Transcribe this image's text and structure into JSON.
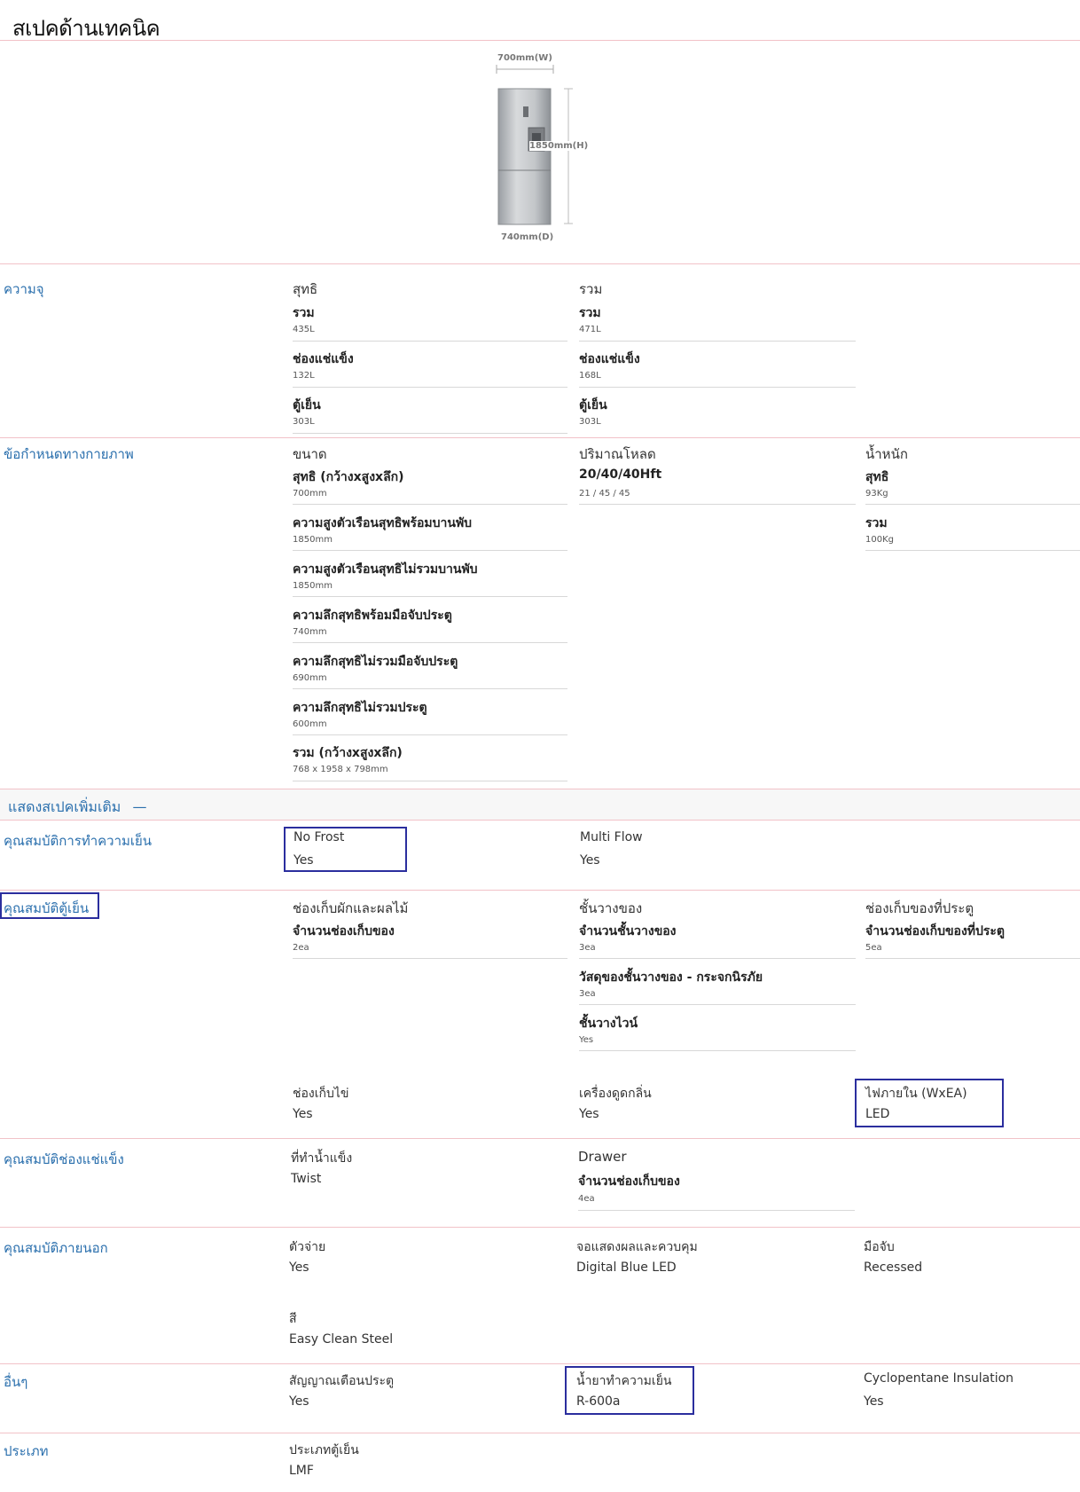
{
  "page_title": "สเปคด้านเทคนิค",
  "figure": {
    "width_label": "700mm(W)",
    "height_label": "1850mm(H)",
    "depth_label": "740mm(D)"
  },
  "capacity": {
    "label": "ความจุ",
    "net": {
      "heading": "สุทธิ",
      "items": [
        {
          "name": "รวม",
          "value": "435L"
        },
        {
          "name": "ช่องแช่แข็ง",
          "value": "132L"
        },
        {
          "name": "ตู้เย็น",
          "value": "303L"
        }
      ]
    },
    "total": {
      "heading": "รวม",
      "items": [
        {
          "name": "รวม",
          "value": "471L"
        },
        {
          "name": "ช่องแช่แข็ง",
          "value": "168L"
        },
        {
          "name": "ตู้เย็น",
          "value": "303L"
        }
      ]
    }
  },
  "physical": {
    "label": "ข้อกำหนดทางกายภาพ",
    "size": {
      "heading": "ขนาด",
      "items": [
        {
          "name": "สุทธิ (กว้างxสูงxลึก)",
          "value": "700mm"
        },
        {
          "name": "ความสูงตัวเรือนสุทธิพร้อมบานพับ",
          "value": "1850mm"
        },
        {
          "name": "ความสูงตัวเรือนสุทธิไม่รวมบานพับ",
          "value": "1850mm"
        },
        {
          "name": "ความลึกสุทธิพร้อมมือจับประตู",
          "value": "740mm"
        },
        {
          "name": "ความลึกสุทธิไม่รวมมือจับประตู",
          "value": "690mm"
        },
        {
          "name": "ความลึกสุทธิไม่รวมประตู",
          "value": "600mm"
        },
        {
          "name": "รวม (กว้างxสูงxลึก)",
          "value": "768 x 1958 x 798mm"
        }
      ]
    },
    "load": {
      "heading": "ปริมาณโหลด",
      "items": [
        {
          "name": "20/40/40Hft",
          "value": "21 / 45 / 45"
        }
      ]
    },
    "weight": {
      "heading": "น้ำหนัก",
      "items": [
        {
          "name": "สุทธิ",
          "value": "93Kg"
        },
        {
          "name": "รวม",
          "value": "100Kg"
        }
      ]
    }
  },
  "more_spec": {
    "label": "แสดงสเปคเพิ่มเติม",
    "toggle_symbol": "—"
  },
  "cooling": {
    "label": "คุณสมบัติการทำความเย็น",
    "c1": {
      "name": "No Frost",
      "value": "Yes"
    },
    "c2": {
      "name": "Multi Flow",
      "value": "Yes"
    }
  },
  "fridge": {
    "label": "คุณสมบัติตู้เย็น",
    "veg": {
      "heading": "ช่องเก็บผักและผลไม้",
      "items": [
        {
          "name": "จำนวนช่องเก็บของ",
          "value": "2ea"
        }
      ]
    },
    "shelf": {
      "heading": "ชั้นวางของ",
      "items": [
        {
          "name": "จำนวนชั้นวางของ",
          "value": "3ea"
        },
        {
          "name": "วัสดุของชั้นวางของ - กระจกนิรภัย",
          "value": "3ea"
        },
        {
          "name": "ชั้นวางไวน์",
          "value": "Yes"
        }
      ]
    },
    "door": {
      "heading": "ช่องเก็บของที่ประตู",
      "items": [
        {
          "name": "จำนวนช่องเก็บของที่ประตู",
          "value": "5ea"
        }
      ]
    },
    "egg": {
      "name": "ช่องเก็บไข่",
      "value": "Yes"
    },
    "deodorizer": {
      "name": "เครื่องดูดกลิ่น",
      "value": "Yes"
    },
    "light": {
      "name": "ไฟภายใน (WxEA)",
      "value": "LED"
    }
  },
  "freezer": {
    "label": "คุณสมบัติช่องแช่แข็ง",
    "ice": {
      "name": "ที่ทำน้ำแข็ง",
      "value": "Twist"
    },
    "drawer": {
      "heading": "Drawer",
      "items": [
        {
          "name": "จำนวนช่องเก็บของ",
          "value": "4ea"
        }
      ]
    }
  },
  "exterior": {
    "label": "คุณสมบัติภายนอก",
    "dispenser": {
      "name": "ตัวจ่าย",
      "value": "Yes"
    },
    "display": {
      "name": "จอแสดงผลและควบคุม",
      "value": "Digital Blue LED"
    },
    "handle": {
      "name": "มือจับ",
      "value": "Recessed"
    },
    "color": {
      "name": "สี",
      "value": "Easy Clean Steel"
    }
  },
  "other": {
    "label": "อื่นๆ",
    "alarm": {
      "name": "สัญญาณเตือนประตู",
      "value": "Yes"
    },
    "refrigerant": {
      "name": "น้ำยาทำความเย็น",
      "value": "R-600a"
    },
    "insulation": {
      "name": "Cyclopentane Insulation",
      "value": "Yes"
    }
  },
  "type": {
    "label": "ประเภท",
    "fridge_type": {
      "name": "ประเภทตู้เย็น",
      "value": "LMF"
    }
  },
  "colors": {
    "accent_blue": "#2a6fad",
    "divider_pink": "#f2c2c8",
    "highlight_box": "#2b2e9e"
  }
}
